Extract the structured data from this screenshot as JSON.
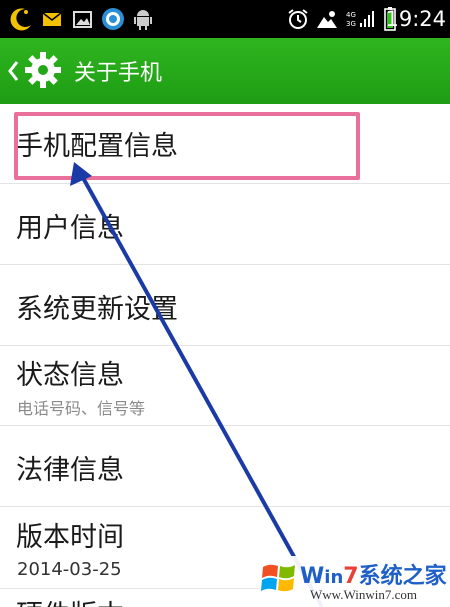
{
  "status_bar": {
    "time": "19:24",
    "network_top": "4G",
    "network_bottom": "3G",
    "icons": [
      "moon-icon",
      "email-icon",
      "image-icon",
      "headset-app-icon",
      "android-icon",
      "alarm-icon",
      "weather-icon",
      "signal-icon",
      "battery-icon"
    ]
  },
  "action_bar": {
    "title": "关于手机",
    "back_icon": "chevron-left-icon",
    "settings_icon": "gear-icon",
    "color": "#23a618"
  },
  "list": {
    "items": [
      {
        "title": "手机配置信息"
      },
      {
        "title": "用户信息"
      },
      {
        "title": "系统更新设置"
      },
      {
        "title": "状态信息",
        "subtitle": "电话号码、信号等"
      },
      {
        "title": "法律信息"
      },
      {
        "title": "版本时间",
        "subtitle": "2014-03-25"
      },
      {
        "title": "硬件版本"
      }
    ]
  },
  "annotation": {
    "highlight_color": "#e8709a",
    "arrow_color": "#1a3aa6"
  },
  "watermark": {
    "brand_w": "W",
    "brand_in": "in",
    "brand_7": "7",
    "brand_rest": "系统之家",
    "url": "Www.Winwin7.com"
  }
}
